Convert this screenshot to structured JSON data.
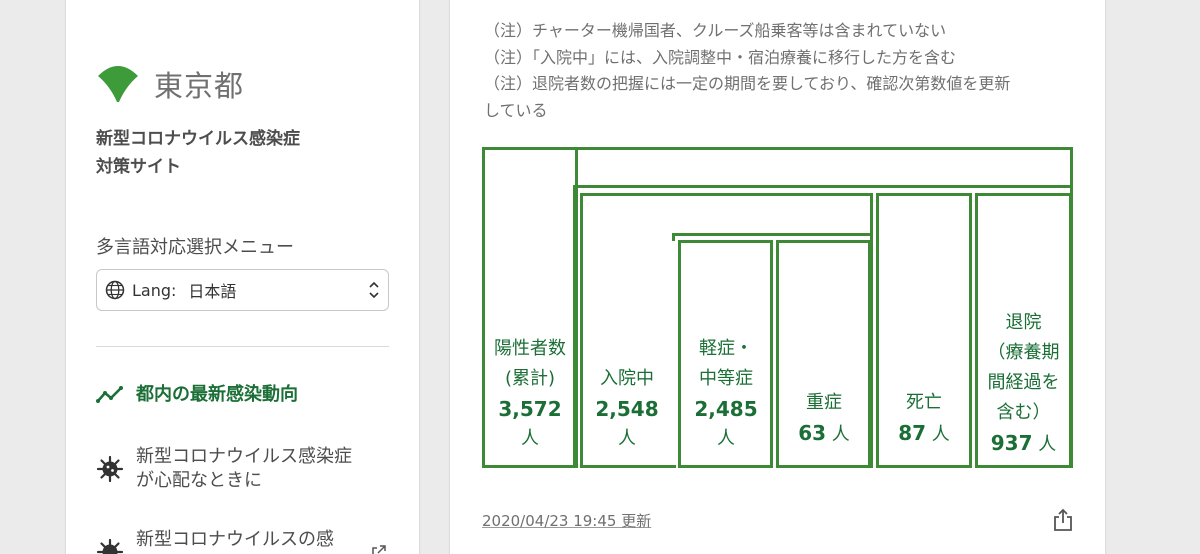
{
  "sidebar": {
    "logo_text": "東京都",
    "site_title_line1": "新型コロナウイルス感染症",
    "site_title_line2": "対策サイト",
    "lang_heading": "多言語対応選択メニュー",
    "lang_select": {
      "label": "Lang:",
      "value": "日本語"
    },
    "nav": [
      {
        "label": "都内の最新感染動向",
        "icon": "trend-icon",
        "active": true
      },
      {
        "label": "新型コロナウイルス感染症が心配なときに",
        "label_line1": "新型コロナウイルス感染症",
        "label_line2": "が心配なときに",
        "icon": "virus-icon"
      },
      {
        "label": "新型コロナウイルスの感",
        "icon": "virus-icon"
      }
    ],
    "brand_color": "#3e9b3a"
  },
  "card": {
    "notes": [
      "（注）チャーター機帰国者、クルーズ船乗客等は含まれていない",
      "（注）「入院中」には、入院調整中・宿泊療養に移行した方を含む",
      "（注）退院者数の把握には一定の期間を要しており、確認次第数値を更新している"
    ],
    "note3_line1": "（注）退院者数の把握には一定の期間を要しており、確認次第数値を更新",
    "note3_line2": "している",
    "updated": "2020/04/23 19:45 更新",
    "accent_color": "#3e8936",
    "text_color": "#1b6f36"
  },
  "chart_data": {
    "type": "table",
    "categories": [
      "陽性者数(累計)",
      "入院中",
      "軽症・中等症",
      "重症",
      "死亡",
      "退院（療養期間経過を含む）"
    ],
    "values": [
      3572,
      2548,
      2485,
      63,
      87,
      937
    ],
    "unit": "人",
    "labels": {
      "positive_l1": "陽性者数",
      "positive_l2": "(累計)",
      "positive_num": "3,572",
      "positive_unit": "人",
      "hosp_l1": "入院中",
      "hosp_num": "2,548",
      "hosp_unit": "人",
      "mild_l1": "軽症・",
      "mild_l2": "中等症",
      "mild_num": "2,485",
      "mild_unit": "人",
      "severe_l1": "重症",
      "severe_num": "63",
      "severe_unit": "人",
      "death_l1": "死亡",
      "death_num": "87",
      "death_unit": "人",
      "disch_l1": "退院",
      "disch_l2": "（療養期",
      "disch_l3": "間経過を",
      "disch_l4": "含む）",
      "disch_num": "937",
      "disch_unit": "人"
    }
  }
}
